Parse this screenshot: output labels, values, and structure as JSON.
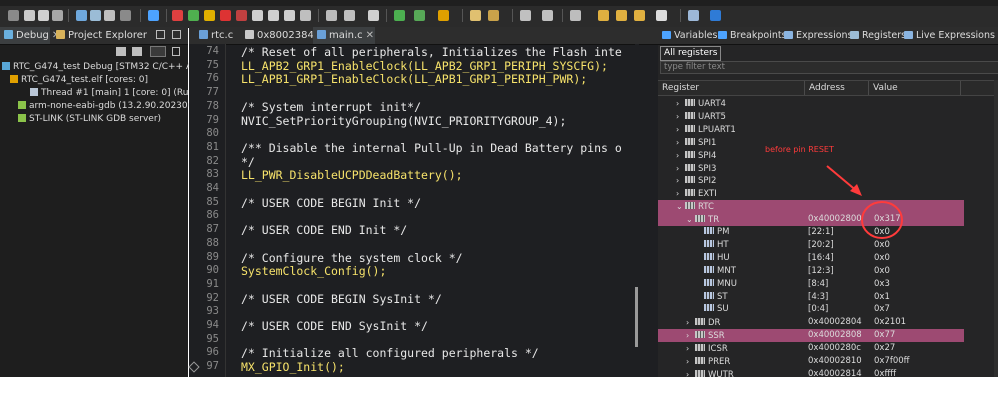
{
  "left_tabs": {
    "debug": "Debug",
    "project_explorer": "Project Explorer"
  },
  "debug_tree": [
    "RTC_G474_test Debug [STM32 C/C++ Appli",
    "RTC_G474_test.elf [cores: 0]",
    "Thread #1 [main] 1 [core: 0] (Running",
    "arm-none-eabi-gdb (13.2.90.20230627)",
    "ST-LINK (ST-LINK GDB server)"
  ],
  "editor_tabs": [
    "rtc.c",
    "0x8002384",
    "main.c"
  ],
  "editor": {
    "lines": [
      {
        "n": "74",
        "text": "/* Reset of all peripherals, Initializes the Flash inte",
        "kind": "cm"
      },
      {
        "n": "75",
        "text": "LL_APB2_GRP1_EnableClock(LL_APB2_GRP1_PERIPH_SYSCFG);",
        "kind": "fn"
      },
      {
        "n": "76",
        "text": "LL_APB1_GRP1_EnableClock(LL_APB1_GRP1_PERIPH_PWR);",
        "kind": "fn"
      },
      {
        "n": "77",
        "text": "",
        "kind": "cm"
      },
      {
        "n": "78",
        "text": "/* System interrupt init*/",
        "kind": "cm"
      },
      {
        "n": "79",
        "text": "NVIC_SetPriorityGrouping(NVIC_PRIORITYGROUP_4);",
        "kind": "cm"
      },
      {
        "n": "80",
        "text": "",
        "kind": "cm"
      },
      {
        "n": "81",
        "text": "/** Disable the internal Pull-Up in Dead Battery pins o",
        "kind": "cm"
      },
      {
        "n": "82",
        "text": "*/",
        "kind": "cm"
      },
      {
        "n": "83",
        "text": "LL_PWR_DisableUCPDDeadBattery();",
        "kind": "fn"
      },
      {
        "n": "84",
        "text": "",
        "kind": "cm"
      },
      {
        "n": "85",
        "text": "/* USER CODE BEGIN Init */",
        "kind": "cm"
      },
      {
        "n": "86",
        "text": "",
        "kind": "cm"
      },
      {
        "n": "87",
        "text": "/* USER CODE END Init */",
        "kind": "cm"
      },
      {
        "n": "88",
        "text": "",
        "kind": "cm"
      },
      {
        "n": "89",
        "text": "/* Configure the system clock */",
        "kind": "cm"
      },
      {
        "n": "90",
        "text": "SystemClock_Config();",
        "kind": "fn"
      },
      {
        "n": "91",
        "text": "",
        "kind": "cm"
      },
      {
        "n": "92",
        "text": "/* USER CODE BEGIN SysInit */",
        "kind": "cm"
      },
      {
        "n": "93",
        "text": "",
        "kind": "cm"
      },
      {
        "n": "94",
        "text": "/* USER CODE END SysInit */",
        "kind": "cm"
      },
      {
        "n": "95",
        "text": "",
        "kind": "cm"
      },
      {
        "n": "96",
        "text": "/* Initialize all configured peripherals */",
        "kind": "cm"
      },
      {
        "n": "97",
        "text": "MX_GPIO_Init();",
        "kind": "fn"
      }
    ]
  },
  "right_tabs": [
    "Variables",
    "Breakpoints",
    "Expressions",
    "Registers",
    "Live Expressions"
  ],
  "registers": {
    "all_tab": "All registers",
    "filter_placeholder": "type filter text",
    "columns": [
      "Register",
      "Address",
      "Value"
    ],
    "rows": [
      {
        "name": "UART4",
        "addr": "",
        "val": "",
        "level": 1,
        "chev": "right",
        "hl": false,
        "kind": "periph"
      },
      {
        "name": "UART5",
        "addr": "",
        "val": "",
        "level": 1,
        "chev": "right",
        "hl": false,
        "kind": "periph"
      },
      {
        "name": "LPUART1",
        "addr": "",
        "val": "",
        "level": 1,
        "chev": "right",
        "hl": false,
        "kind": "periph"
      },
      {
        "name": "SPI1",
        "addr": "",
        "val": "",
        "level": 1,
        "chev": "right",
        "hl": false,
        "kind": "periph"
      },
      {
        "name": "SPI4",
        "addr": "",
        "val": "",
        "level": 1,
        "chev": "right",
        "hl": false,
        "kind": "periph"
      },
      {
        "name": "SPI3",
        "addr": "",
        "val": "",
        "level": 1,
        "chev": "right",
        "hl": false,
        "kind": "periph"
      },
      {
        "name": "SPI2",
        "addr": "",
        "val": "",
        "level": 1,
        "chev": "right",
        "hl": false,
        "kind": "periph"
      },
      {
        "name": "EXTI",
        "addr": "",
        "val": "",
        "level": 1,
        "chev": "right",
        "hl": false,
        "kind": "periph"
      },
      {
        "name": "RTC",
        "addr": "",
        "val": "",
        "level": 1,
        "chev": "down",
        "hl": true,
        "kind": "periph"
      },
      {
        "name": "TR",
        "addr": "0x40002800",
        "val": "0x317",
        "level": 2,
        "chev": "down",
        "hl": true,
        "kind": "reg"
      },
      {
        "name": "PM",
        "addr": "[22:1]",
        "val": "0x0",
        "level": 3,
        "chev": "",
        "hl": false,
        "kind": "fld"
      },
      {
        "name": "HT",
        "addr": "[20:2]",
        "val": "0x0",
        "level": 3,
        "chev": "",
        "hl": false,
        "kind": "fld"
      },
      {
        "name": "HU",
        "addr": "[16:4]",
        "val": "0x0",
        "level": 3,
        "chev": "",
        "hl": false,
        "kind": "fld"
      },
      {
        "name": "MNT",
        "addr": "[12:3]",
        "val": "0x0",
        "level": 3,
        "chev": "",
        "hl": false,
        "kind": "fld"
      },
      {
        "name": "MNU",
        "addr": "[8:4]",
        "val": "0x3",
        "level": 3,
        "chev": "",
        "hl": false,
        "kind": "fld"
      },
      {
        "name": "ST",
        "addr": "[4:3]",
        "val": "0x1",
        "level": 3,
        "chev": "",
        "hl": false,
        "kind": "fld"
      },
      {
        "name": "SU",
        "addr": "[0:4]",
        "val": "0x7",
        "level": 3,
        "chev": "",
        "hl": false,
        "kind": "fld"
      },
      {
        "name": "DR",
        "addr": "0x40002804",
        "val": "0x2101",
        "level": 2,
        "chev": "right",
        "hl": false,
        "kind": "reg"
      },
      {
        "name": "SSR",
        "addr": "0x40002808",
        "val": "0x77",
        "level": 2,
        "chev": "right",
        "hl": true,
        "kind": "reg"
      },
      {
        "name": "ICSR",
        "addr": "0x4000280c",
        "val": "0x27",
        "level": 2,
        "chev": "right",
        "hl": false,
        "kind": "reg"
      },
      {
        "name": "PRER",
        "addr": "0x40002810",
        "val": "0x7f00ff",
        "level": 2,
        "chev": "right",
        "hl": false,
        "kind": "reg"
      },
      {
        "name": "WUTR",
        "addr": "0x40002814",
        "val": "0xffff",
        "level": 2,
        "chev": "right",
        "hl": false,
        "kind": "reg"
      }
    ]
  },
  "annotation": "before pin RESET",
  "colors": {
    "highlight": "#9d4a72",
    "annotation": "#ff3b3b"
  }
}
